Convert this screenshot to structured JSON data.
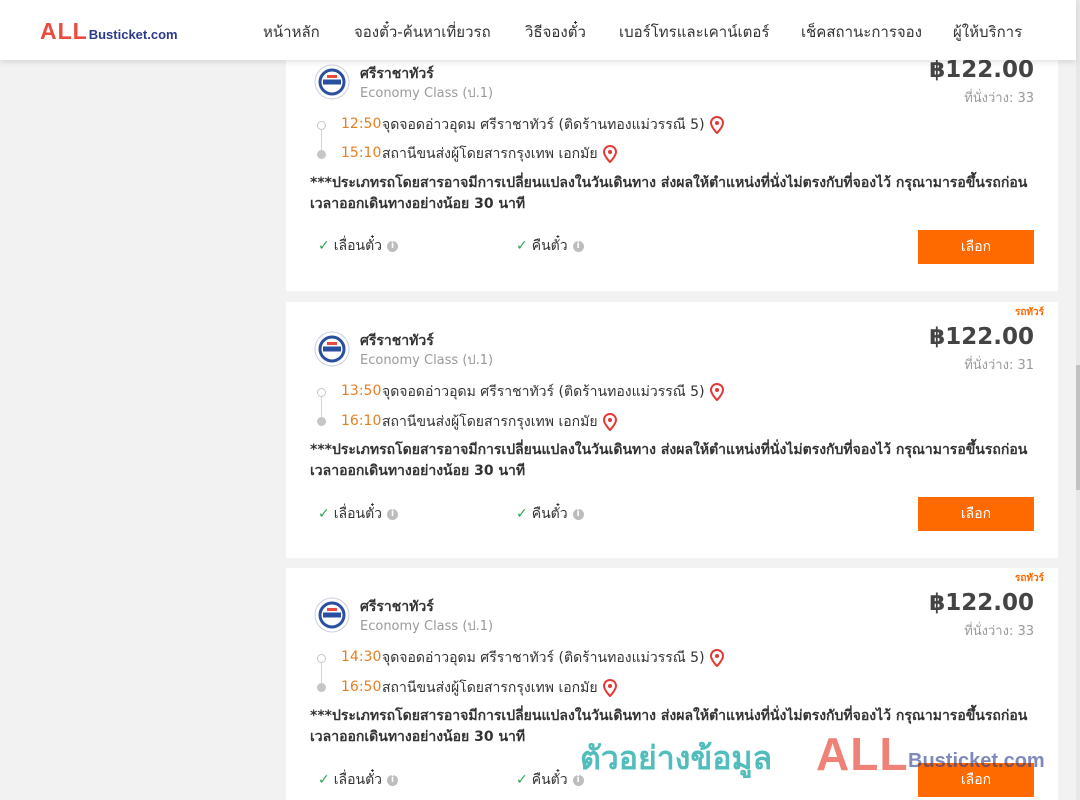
{
  "brand": {
    "logo_all": "ALL",
    "logo_rest": "Busticket.com"
  },
  "nav": [
    {
      "label": "หน้าหลัก"
    },
    {
      "label": "จองตั๋ว-ค้นหาเที่ยวรถ"
    },
    {
      "label": "วิธีจองตั๋ว"
    },
    {
      "label": "เบอร์โทรและเคาน์เตอร์"
    },
    {
      "label": "เช็คสถานะการจอง"
    },
    {
      "label": "ผู้ให้บริการ"
    }
  ],
  "trips": [
    {
      "tag": "",
      "operator": "ศรีราชาทัวร์",
      "class": "Economy Class (ป.1)",
      "price": "฿122.00",
      "seats": "ที่นั่งว่าง: 33",
      "depart_time": "12:50",
      "depart_place": "จุดจอดอ่าวอุดม ศรีราชาทัวร์ (ติดร้านทองแม่วรรณี 5)",
      "arrive_time": "15:10",
      "arrive_place": "สถานีขนส่งผู้โดยสารกรุงเทพ เอกมัย",
      "notice": "***ประเภทรถโดยสารอาจมีการเปลี่ยนแปลงในวันเดินทาง ส่งผลให้ตำแหน่งที่นั่งไม่ตรงกับที่จองไว้ กรุณามารอขึ้นรถก่อนเวลาออกเดินทางอย่างน้อย 30 นาที",
      "feature_1": "เลื่อนตั๋ว",
      "feature_2": "คืนตั๋ว",
      "button": "เลือก"
    },
    {
      "tag": "รถทัวร์",
      "operator": "ศรีราชาทัวร์",
      "class": "Economy Class (ป.1)",
      "price": "฿122.00",
      "seats": "ที่นั่งว่าง: 31",
      "depart_time": "13:50",
      "depart_place": "จุดจอดอ่าวอุดม ศรีราชาทัวร์ (ติดร้านทองแม่วรรณี 5)",
      "arrive_time": "16:10",
      "arrive_place": "สถานีขนส่งผู้โดยสารกรุงเทพ เอกมัย",
      "notice": "***ประเภทรถโดยสารอาจมีการเปลี่ยนแปลงในวันเดินทาง ส่งผลให้ตำแหน่งที่นั่งไม่ตรงกับที่จองไว้ กรุณามารอขึ้นรถก่อนเวลาออกเดินทางอย่างน้อย 30 นาที",
      "feature_1": "เลื่อนตั๋ว",
      "feature_2": "คืนตั๋ว",
      "button": "เลือก"
    },
    {
      "tag": "รถทัวร์",
      "operator": "ศรีราชาทัวร์",
      "class": "Economy Class (ป.1)",
      "price": "฿122.00",
      "seats": "ที่นั่งว่าง: 33",
      "depart_time": "14:30",
      "depart_place": "จุดจอดอ่าวอุดม ศรีราชาทัวร์ (ติดร้านทองแม่วรรณี 5)",
      "arrive_time": "16:50",
      "arrive_place": "สถานีขนส่งผู้โดยสารกรุงเทพ เอกมัย",
      "notice": "***ประเภทรถโดยสารอาจมีการเปลี่ยนแปลงในวันเดินทาง ส่งผลให้ตำแหน่งที่นั่งไม่ตรงกับที่จองไว้ กรุณามารอขึ้นรถก่อนเวลาออกเดินทางอย่างน้อย 30 นาที",
      "feature_1": "เลื่อนตั๋ว",
      "feature_2": "คืนตั๋ว",
      "button": "เลือก"
    }
  ],
  "watermark": {
    "thai": "ตัวอย่างข้อมูล",
    "logo_all": "ALL",
    "logo_rest": "Busticket.com"
  },
  "colors": {
    "accent": "#ff6a00",
    "brand_red": "#e94b3c",
    "brand_blue": "#2a3a8c",
    "time": "#e67e22",
    "check": "#2ea44f",
    "watermark": "#009e9e"
  }
}
